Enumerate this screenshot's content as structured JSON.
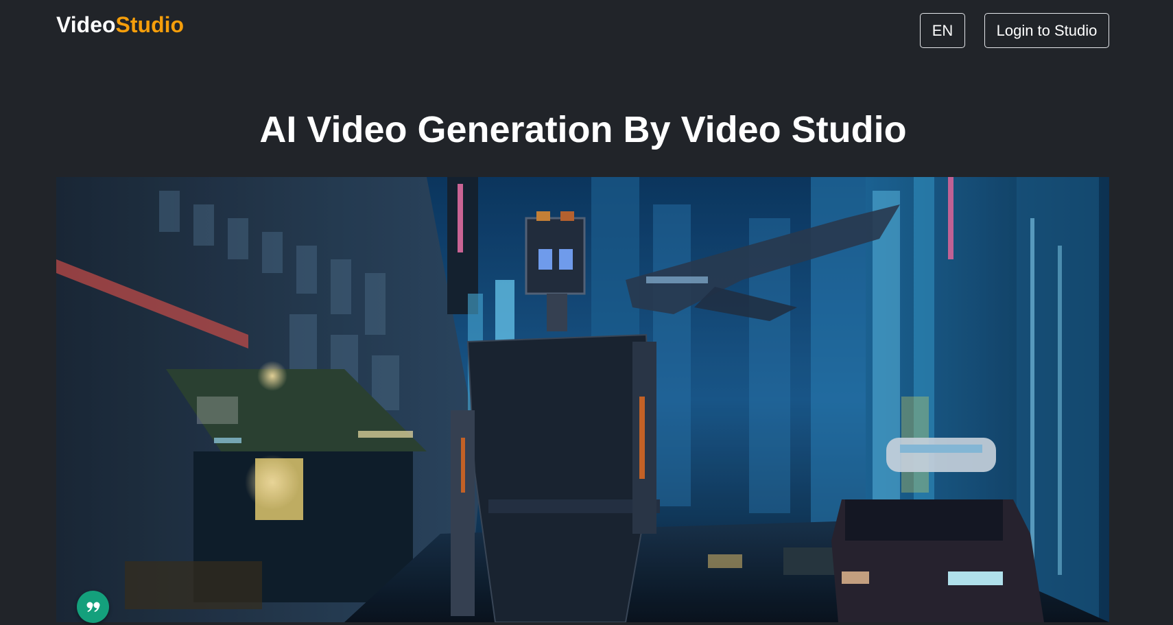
{
  "header": {
    "brand_primary": "Video",
    "brand_accent": "Studio",
    "language_label": "EN",
    "login_label": "Login to Studio"
  },
  "hero": {
    "title": "AI Video Generation By Video Studio"
  },
  "colors": {
    "background": "#212429",
    "brand_accent": "#f59e0b",
    "fab": "#14a07c"
  },
  "icons": {
    "fab_icon": "quote-icon"
  }
}
